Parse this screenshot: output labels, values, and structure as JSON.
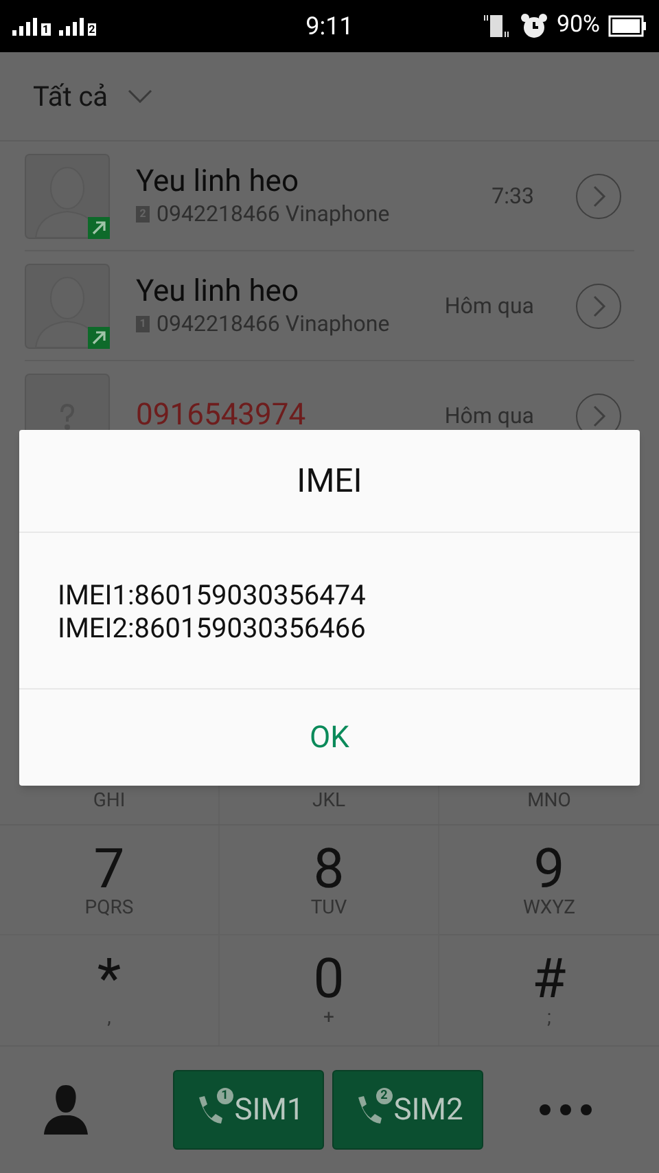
{
  "status_bar": {
    "sims": [
      "1",
      "2"
    ],
    "time": "9:11",
    "battery": "90%"
  },
  "header": {
    "filter": "Tất cả"
  },
  "calls": [
    {
      "kind": "contact",
      "name": "Yeu linh heo",
      "missed": false,
      "sim": "2",
      "detail": "0942218466 Vinaphone",
      "time": "7:33"
    },
    {
      "kind": "contact",
      "name": "Yeu linh heo",
      "missed": false,
      "sim": "1",
      "detail": "0942218466 Vinaphone",
      "time": "Hôm qua"
    },
    {
      "kind": "unknown",
      "name": "0916543974",
      "missed": true,
      "time": "Hôm qua"
    }
  ],
  "dialog": {
    "title": "IMEI",
    "lines": [
      "IMEI1:860159030356474",
      "IMEI2:860159030356466"
    ],
    "button": "OK"
  },
  "keypad": {
    "partial_row": [
      "GHI",
      "JKL",
      "MNO"
    ],
    "keys": [
      {
        "digit": "7",
        "letters": "PQRS"
      },
      {
        "digit": "8",
        "letters": "TUV"
      },
      {
        "digit": "9",
        "letters": "WXYZ"
      },
      {
        "digit": "*",
        "letters": ","
      },
      {
        "digit": "0",
        "letters": "+"
      },
      {
        "digit": "#",
        "letters": ";"
      }
    ]
  },
  "bottom_bar": {
    "sim_buttons": [
      {
        "badge": "1",
        "label": "SIM1"
      },
      {
        "badge": "2",
        "label": "SIM2"
      }
    ]
  }
}
